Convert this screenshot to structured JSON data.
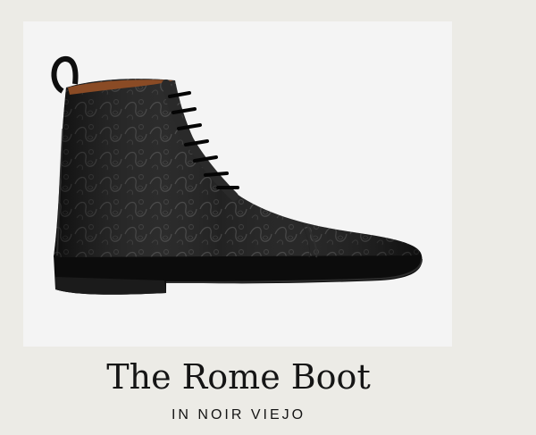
{
  "product": {
    "name": "The Rome Boot",
    "variant": "IN NOIR VIEJO",
    "image_subject": "boot"
  },
  "colors": {
    "page_background": "#ecebe6",
    "photo_background": "#f4f4f4",
    "boot_leather": "#141414",
    "lining": "#8a4b25",
    "text": "#151515"
  }
}
